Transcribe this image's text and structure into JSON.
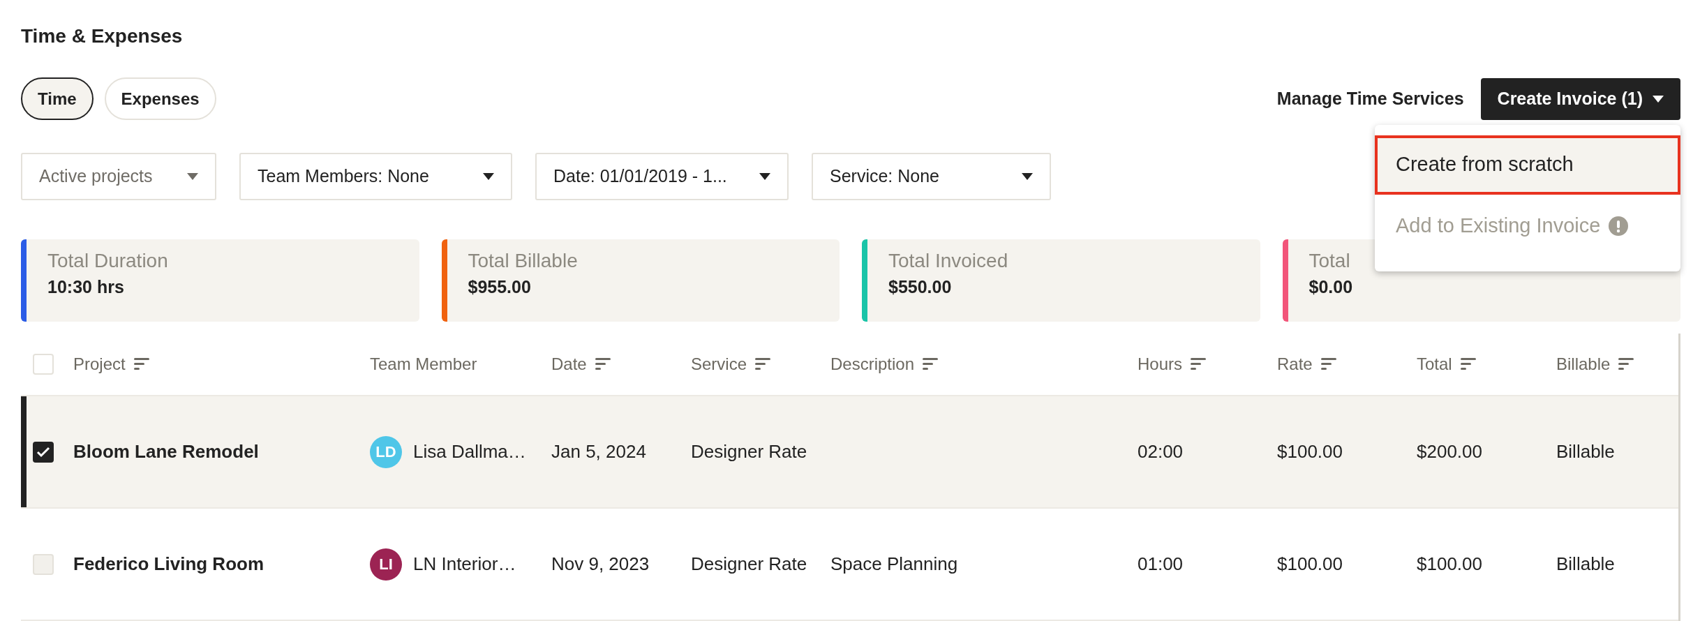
{
  "title": "Time & Expenses",
  "tabs": [
    {
      "label": "Time",
      "selected": true
    },
    {
      "label": "Expenses",
      "selected": false
    }
  ],
  "actions": {
    "link": "Manage Time Services",
    "button": "Create Invoice (1)"
  },
  "menu": {
    "items": [
      {
        "label": "Create from scratch",
        "highlighted": true,
        "disabled": false
      },
      {
        "label": "Add to Existing Invoice",
        "highlighted": false,
        "disabled": true
      }
    ]
  },
  "filters": [
    {
      "label": "Active projects",
      "muted": true
    },
    {
      "label": "Team Members: None",
      "muted": false
    },
    {
      "label": "Date: 01/01/2019 - 1...",
      "muted": false
    },
    {
      "label": "Service: None",
      "muted": false
    }
  ],
  "stats": [
    {
      "label": "Total Duration",
      "value": "10:30 hrs",
      "color": "#2b5ce6"
    },
    {
      "label": "Total Billable",
      "value": "$955.00",
      "color": "#f0620f"
    },
    {
      "label": "Total Invoiced",
      "value": "$550.00",
      "color": "#19c4a8"
    },
    {
      "label": "Total",
      "value": "$0.00",
      "color": "#f2557a"
    }
  ],
  "table": {
    "all_checked": false,
    "columns": [
      {
        "label": "Project",
        "sortable": true
      },
      {
        "label": "Team Member",
        "sortable": false
      },
      {
        "label": "Date",
        "sortable": true
      },
      {
        "label": "Service",
        "sortable": true
      },
      {
        "label": "Description",
        "sortable": true
      },
      {
        "label": "Hours",
        "sortable": true
      },
      {
        "label": "Rate",
        "sortable": true
      },
      {
        "label": "Total",
        "sortable": true
      },
      {
        "label": "Billable",
        "sortable": true
      }
    ],
    "rows": [
      {
        "selected": true,
        "disabled": false,
        "project": "Bloom Lane Remodel",
        "initials": "LD",
        "color": "#4fc6e8",
        "member": "Lisa Dallma…",
        "date": "Jan 5, 2024",
        "service": "Designer Rate",
        "hours": "02:00",
        "rate": "$100.00",
        "total": "$200.00",
        "billable": "Billable"
      },
      {
        "selected": false,
        "disabled": true,
        "project": "Federico Living Room",
        "initials": "LI",
        "color": "#9c2353",
        "member": "LN Interior…",
        "date": "Nov 9, 2023",
        "service": "Designer Rate",
        "description": "Space Planning",
        "hours": "01:00",
        "rate": "$100.00",
        "total": "$100.00",
        "billable": "Billable"
      }
    ]
  }
}
